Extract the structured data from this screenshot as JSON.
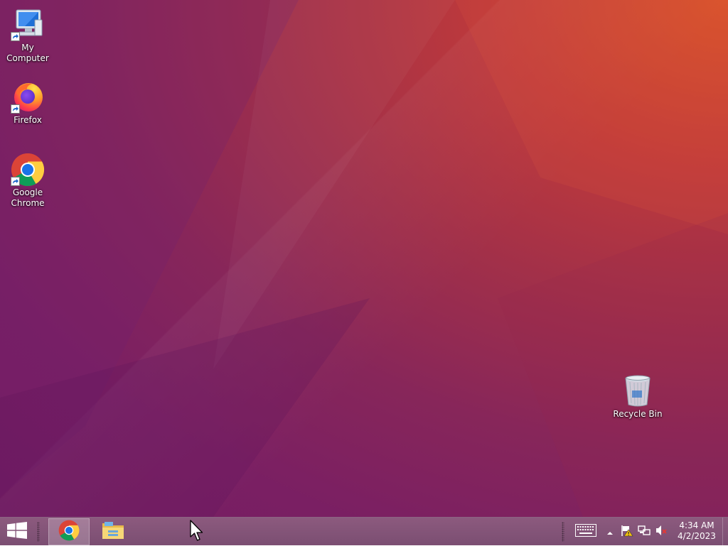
{
  "desktop": {
    "icons": [
      {
        "label": "My Computer",
        "icon": "computer-icon"
      },
      {
        "label": "Firefox",
        "icon": "firefox-icon"
      },
      {
        "label": "Google Chrome",
        "icon": "chrome-icon"
      },
      {
        "label": "Recycle Bin",
        "icon": "recycle-bin-icon"
      }
    ]
  },
  "taskbar": {
    "start_icon": "windows-logo-icon",
    "pinned": [
      {
        "name": "Google Chrome",
        "icon": "chrome-icon",
        "active": true
      },
      {
        "name": "File Explorer",
        "icon": "folder-icon",
        "active": false
      }
    ],
    "tray": {
      "icons": [
        "keyboard-icon",
        "chevron-up-icon",
        "action-center-flag-icon",
        "network-icon",
        "volume-muted-icon"
      ]
    },
    "clock": {
      "time": "4:34 AM",
      "date": "4/2/2023"
    }
  },
  "colors": {
    "wallpaper_top_right": "#d9532a",
    "wallpaper_bottom_left": "#741d62",
    "taskbar": "#82547a"
  }
}
